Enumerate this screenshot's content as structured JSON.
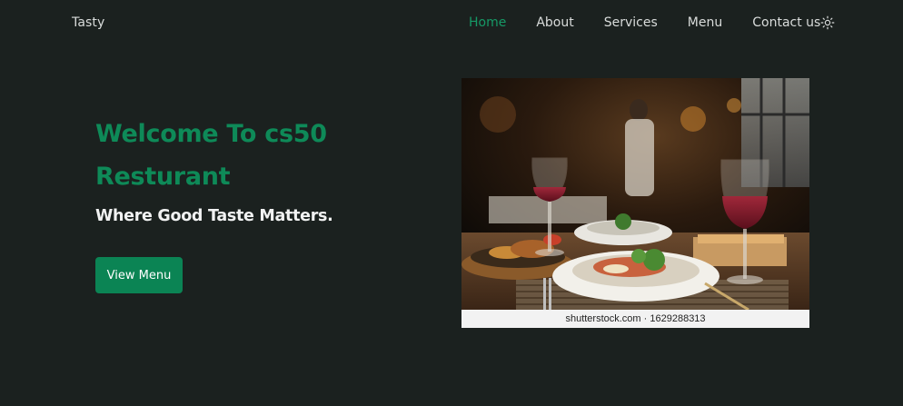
{
  "header": {
    "brand": "Tasty",
    "nav": {
      "home": "Home",
      "about": "About",
      "services": "Services",
      "menu": "Menu",
      "contact": "Contact us"
    },
    "theme_icon": "sun-icon"
  },
  "hero": {
    "title": "Welcome To cs50 Resturant",
    "subtitle": "Where Good Taste Matters.",
    "button": "View Menu"
  },
  "photo": {
    "caption": "shutterstock.com · 1629288313"
  },
  "colors": {
    "background": "#1b211f",
    "accent": "#0b8454",
    "active_nav": "#169966",
    "text": "#d9dcdb"
  }
}
